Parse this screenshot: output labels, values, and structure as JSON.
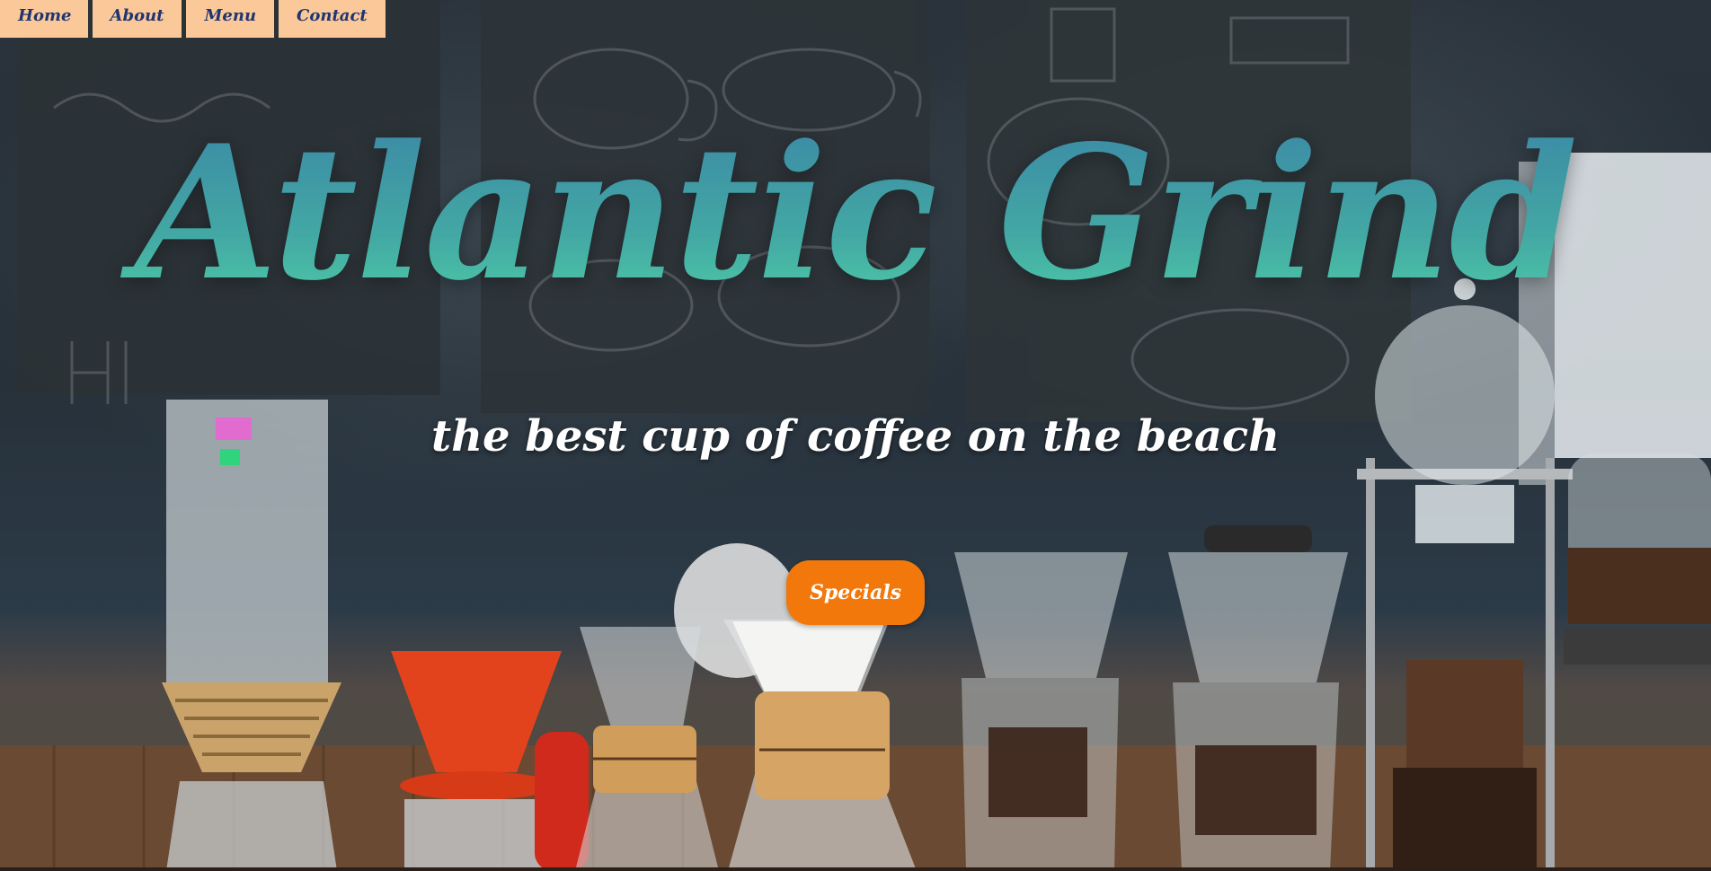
{
  "nav": {
    "items": [
      {
        "label": "Home"
      },
      {
        "label": "About"
      },
      {
        "label": "Menu"
      },
      {
        "label": "Contact"
      }
    ]
  },
  "hero": {
    "title": "Atlantic Grind",
    "subtitle": "the best cup of coffee on the beach",
    "button_label": "Specials"
  },
  "colors": {
    "nav_bg": "#fbc899",
    "nav_text": "#1f3570",
    "title_gradient_top": "#3a86a6",
    "title_gradient_bottom": "#4fd1a7",
    "button_bg": "#f2780c"
  }
}
